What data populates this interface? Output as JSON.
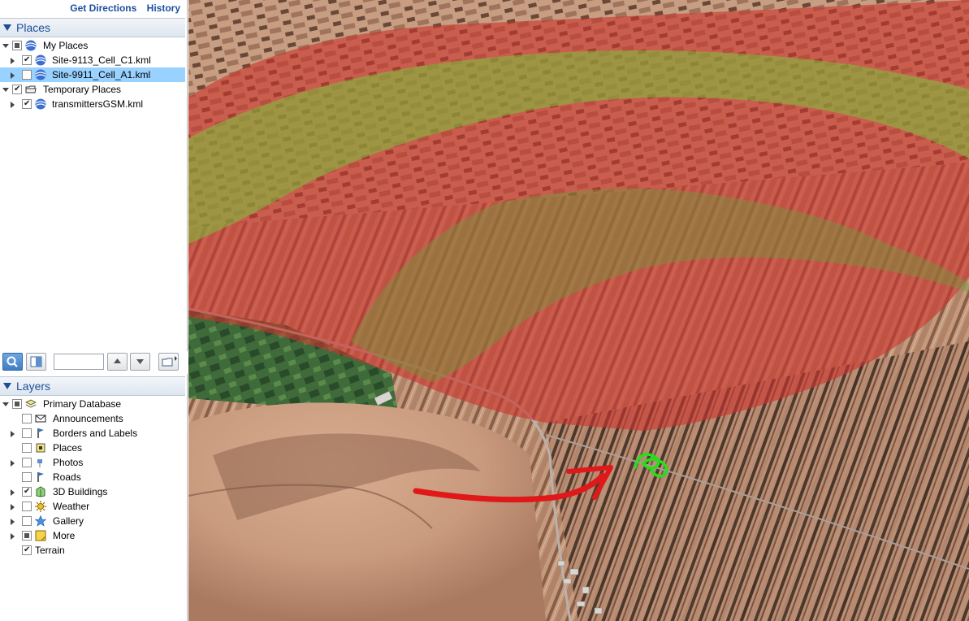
{
  "top_links": {
    "get_directions": "Get Directions",
    "history": "History"
  },
  "places": {
    "header": "Places",
    "items": [
      {
        "label": "My Places",
        "checkbox": "mixed",
        "expanded": true
      },
      {
        "label": "Site-9113_Cell_C1.kml",
        "checkbox": "checked",
        "expanded": false
      },
      {
        "label": "Site-9911_Cell_A1.kml",
        "checkbox": "unchecked",
        "expanded": false,
        "selected": true
      },
      {
        "label": "Temporary Places",
        "checkbox": "checked",
        "expanded": true
      },
      {
        "label": "transmittersGSM.kml",
        "checkbox": "checked",
        "expanded": false
      }
    ]
  },
  "toolbar": {
    "search_value": ""
  },
  "layers": {
    "header": "Layers",
    "items": [
      {
        "label": "Primary Database",
        "checkbox": "mixed",
        "icon": "database-icon"
      },
      {
        "label": "Announcements",
        "checkbox": "unchecked",
        "icon": "envelope-icon"
      },
      {
        "label": "Borders and Labels",
        "checkbox": "unchecked",
        "icon": "flag-icon"
      },
      {
        "label": "Places",
        "checkbox": "unchecked",
        "icon": "places-icon"
      },
      {
        "label": "Photos",
        "checkbox": "unchecked",
        "icon": "photo-icon"
      },
      {
        "label": "Roads",
        "checkbox": "unchecked",
        "icon": "road-icon"
      },
      {
        "label": "3D Buildings",
        "checkbox": "checked",
        "icon": "building-icon"
      },
      {
        "label": "Weather",
        "checkbox": "unchecked",
        "icon": "sun-icon"
      },
      {
        "label": "Gallery",
        "checkbox": "unchecked",
        "icon": "star-icon"
      },
      {
        "label": "More",
        "checkbox": "mixed",
        "icon": "more-icon"
      },
      {
        "label": "Terrain",
        "checkbox": "checked",
        "icon": ""
      }
    ]
  },
  "colors": {
    "header_text": "#1d4e97",
    "selection": "#99d1ff",
    "coverage_red": "#c9362e",
    "coverage_green": "#6fbf3a",
    "arrow_red": "#e0181a",
    "marker_green": "#22e01a"
  }
}
